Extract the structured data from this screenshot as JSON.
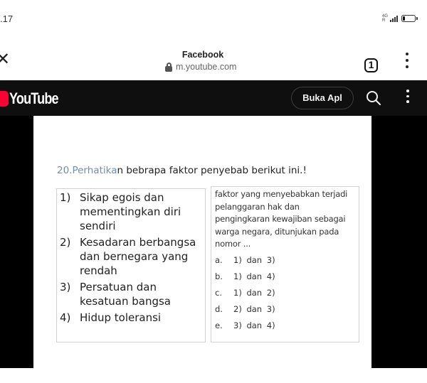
{
  "status_bar": {
    "time": ".17",
    "network_type": "4G",
    "signal_sub": "R",
    "battery_icon": "battery-low-icon",
    "signal_icon": "signal-icon"
  },
  "browser": {
    "close_icon": "close-icon",
    "title": "Facebook",
    "url": "m.youtube.com",
    "lock_icon": "lock-icon",
    "tab_count": "1",
    "menu_icon": "more-vert-icon"
  },
  "youtube": {
    "logo_text": "YouTube",
    "open_app_label": "Buka Apl",
    "search_icon": "search-icon",
    "menu_icon": "more-vert-icon"
  },
  "video": {
    "question_highlight": "20.Perhatika",
    "question_rest": "n bebrapa faktor penyebab berikut ini.!",
    "factors": [
      {
        "num": "1)",
        "text": "Sikap egois dan mementingkan diri sendiri"
      },
      {
        "num": "2)",
        "text": "Kesadaran berbangsa dan bernegara yang rendah"
      },
      {
        "num": "3)",
        "text": "Persatuan dan kesatuan bangsa"
      },
      {
        "num": "4)",
        "text": "Hidup toleransi"
      }
    ],
    "stem": "faktor yang menyebabkan terjadi pelanggaran hak dan pengingkaran kewajiban sebagai warga negara, ditunjukan pada nomor ...",
    "options": [
      {
        "letter": "a.",
        "answer": "1) dan 3)"
      },
      {
        "letter": "b.",
        "answer": "1) dan 4)"
      },
      {
        "letter": "c.",
        "answer": "1) dan 2)"
      },
      {
        "letter": "d.",
        "answer": "2) dan 3)"
      },
      {
        "letter": "e.",
        "answer": "3) dan 4)"
      }
    ]
  },
  "colors": {
    "youtube_red": "#ff0033",
    "header_bg": "#0f0f0f",
    "question_highlight": "#6f8fb0"
  }
}
